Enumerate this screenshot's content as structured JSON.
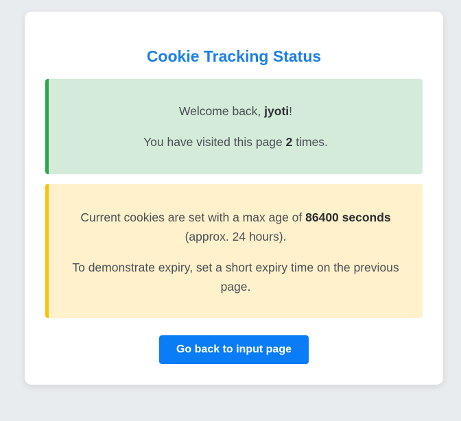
{
  "page": {
    "title": "Cookie Tracking Status"
  },
  "welcome": {
    "prefix": "Welcome back, ",
    "username": "jyoti",
    "suffix": "!"
  },
  "visits": {
    "prefix": "You have visited this page ",
    "count": "2",
    "suffix": " times."
  },
  "cookie_info": {
    "prefix": "Current cookies are set with a max age of ",
    "max_age": "86400 seconds",
    "suffix": " (approx. 24 hours).",
    "hint": "To demonstrate expiry, set a short expiry time on the previous page."
  },
  "actions": {
    "back_label": "Go back to input page"
  },
  "colors": {
    "background": "#e9ecef",
    "title": "#1a7fe8",
    "success_bg": "#d4ebd9",
    "success_border": "#2aa84a",
    "warning_bg": "#fff1cc",
    "warning_border": "#ffc107",
    "button": "#0a7cf5"
  }
}
